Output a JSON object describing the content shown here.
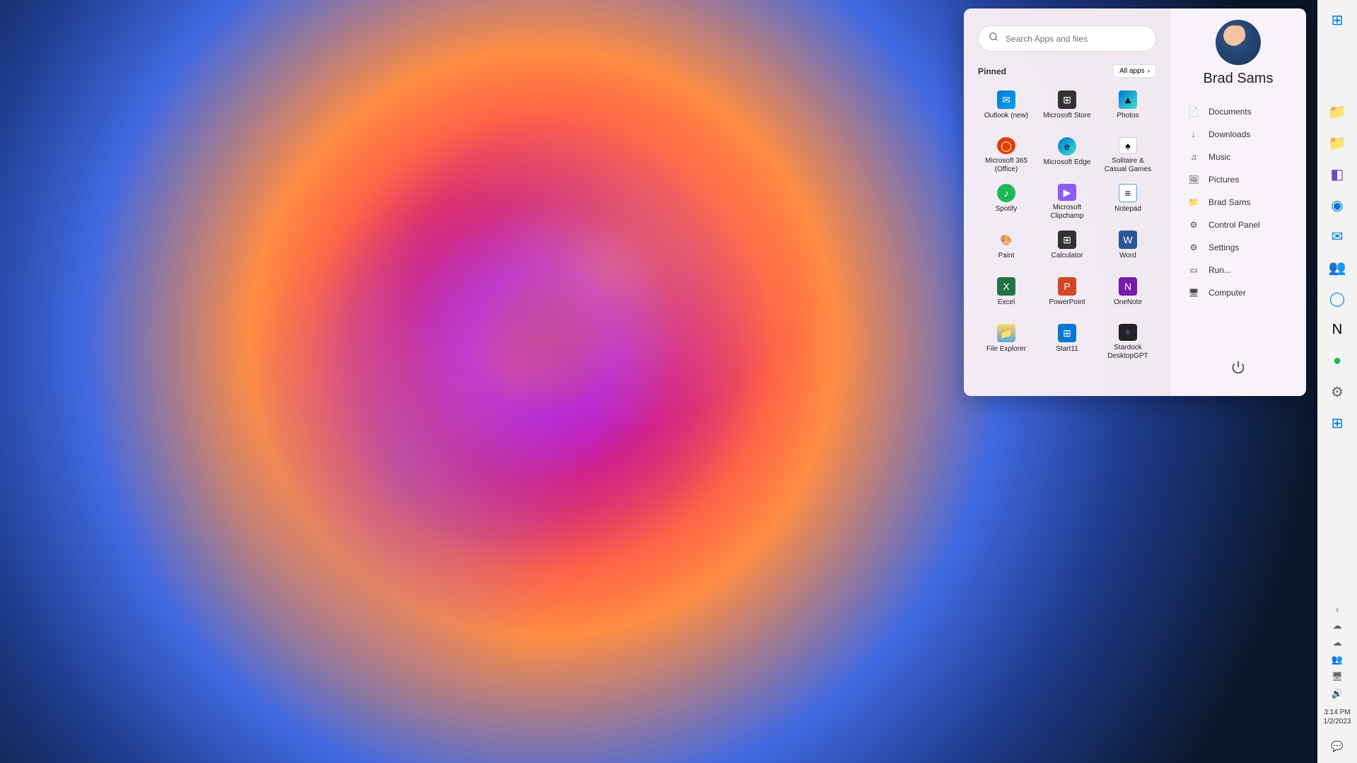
{
  "user": {
    "name": "Brad Sams"
  },
  "search": {
    "placeholder": "Search Apps and files"
  },
  "pinned": {
    "title": "Pinned",
    "all_apps": "All apps",
    "apps": [
      {
        "label": "Outlook (new)",
        "cls": "ic-outlook",
        "glyph": "✉"
      },
      {
        "label": "Microsoft Store",
        "cls": "ic-store",
        "glyph": "⊞"
      },
      {
        "label": "Photos",
        "cls": "ic-photos",
        "glyph": "▲"
      },
      {
        "label": "Microsoft 365 (Office)",
        "cls": "ic-365",
        "glyph": "◯"
      },
      {
        "label": "Microsoft Edge",
        "cls": "ic-edge",
        "glyph": "e"
      },
      {
        "label": "Solitaire & Casual Games",
        "cls": "ic-solitaire",
        "glyph": "♠"
      },
      {
        "label": "Spotify",
        "cls": "ic-spotify",
        "glyph": "♪"
      },
      {
        "label": "Microsoft Clipchamp",
        "cls": "ic-clipchamp",
        "glyph": "▶"
      },
      {
        "label": "Notepad",
        "cls": "ic-notepad",
        "glyph": "≡"
      },
      {
        "label": "Paint",
        "cls": "ic-paint",
        "glyph": "🎨"
      },
      {
        "label": "Calculator",
        "cls": "ic-calc",
        "glyph": "⊞"
      },
      {
        "label": "Word",
        "cls": "ic-word",
        "glyph": "W"
      },
      {
        "label": "Excel",
        "cls": "ic-excel",
        "glyph": "X"
      },
      {
        "label": "PowerPoint",
        "cls": "ic-ppt",
        "glyph": "P"
      },
      {
        "label": "OneNote",
        "cls": "ic-onenote",
        "glyph": "N"
      },
      {
        "label": "File Explorer",
        "cls": "ic-explorer",
        "glyph": "📁"
      },
      {
        "label": "Start11",
        "cls": "ic-start11",
        "glyph": "⊞"
      },
      {
        "label": "Stardock DesktopGPT",
        "cls": "ic-stardock",
        "glyph": "✧"
      }
    ]
  },
  "side": [
    {
      "label": "Documents",
      "glyph": "📄",
      "name": "documents"
    },
    {
      "label": "Downloads",
      "glyph": "↓",
      "name": "downloads"
    },
    {
      "label": "Music",
      "glyph": "♫",
      "name": "music"
    },
    {
      "label": "Pictures",
      "glyph": "🖼",
      "name": "pictures"
    },
    {
      "label": "Brad Sams",
      "glyph": "📁",
      "name": "user-folder"
    },
    {
      "label": "Control Panel",
      "glyph": "⚙",
      "name": "control-panel"
    },
    {
      "label": "Settings",
      "glyph": "⚙",
      "name": "settings"
    },
    {
      "label": "Run...",
      "glyph": "▭",
      "name": "run"
    },
    {
      "label": "Computer",
      "glyph": "🖥",
      "name": "computer"
    }
  ],
  "taskbar": {
    "apps": [
      {
        "name": "start",
        "glyph": "⊞",
        "color": "#0078d4"
      },
      {
        "name": "file-explorer",
        "glyph": "📁",
        "color": "#28a745"
      },
      {
        "name": "folder",
        "glyph": "📁",
        "color": "#f0ad4e"
      },
      {
        "name": "app-purple",
        "glyph": "◧",
        "color": "#6f42c1"
      },
      {
        "name": "edge",
        "glyph": "◉",
        "color": "#0078d4"
      },
      {
        "name": "outlook",
        "glyph": "✉",
        "color": "#0078d4"
      },
      {
        "name": "teams",
        "glyph": "👥",
        "color": "#6264a7"
      },
      {
        "name": "onepassword",
        "glyph": "◯",
        "color": "#1a8cff"
      },
      {
        "name": "notion",
        "glyph": "N",
        "color": "#000"
      },
      {
        "name": "spotify",
        "glyph": "●",
        "color": "#1db954"
      },
      {
        "name": "settings",
        "glyph": "⚙",
        "color": "#666"
      },
      {
        "name": "start11",
        "glyph": "⊞",
        "color": "#0078d4"
      }
    ],
    "systray": [
      {
        "name": "expand",
        "glyph": "‹"
      },
      {
        "name": "cloud",
        "glyph": "☁"
      },
      {
        "name": "onedrive",
        "glyph": "☁"
      },
      {
        "name": "teams-tray",
        "glyph": "👥"
      },
      {
        "name": "display",
        "glyph": "🖥"
      },
      {
        "name": "volume",
        "glyph": "🔊"
      }
    ],
    "clock": {
      "time": "3:14 PM",
      "date": "1/2/2023"
    },
    "notifications": {
      "glyph": "💬"
    }
  }
}
